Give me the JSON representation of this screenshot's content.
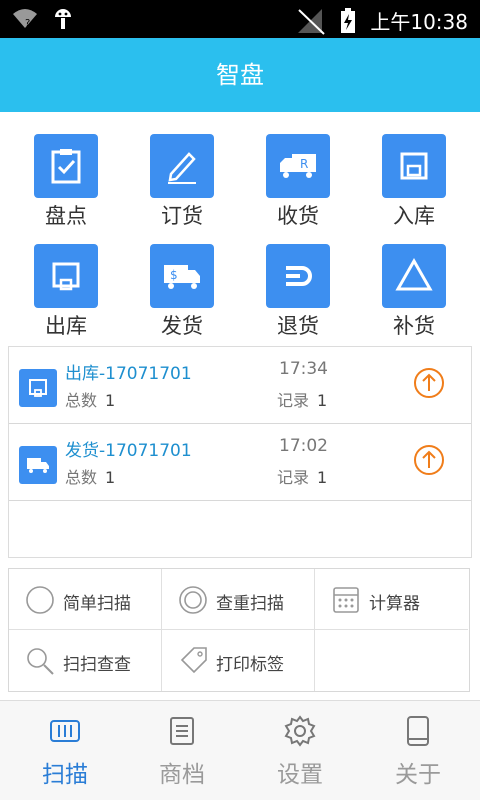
{
  "status": {
    "time": "上午10:38"
  },
  "appbar": {
    "title": "智盘"
  },
  "grid": [
    {
      "label": "盘点",
      "icon": "clipboard-check-icon"
    },
    {
      "label": "订货",
      "icon": "pencil-icon"
    },
    {
      "label": "收货",
      "icon": "truck-r-icon"
    },
    {
      "label": "入库",
      "icon": "inbox-icon"
    },
    {
      "label": "出库",
      "icon": "outbox-icon"
    },
    {
      "label": "发货",
      "icon": "truck-dollar-icon"
    },
    {
      "label": "退货",
      "icon": "return-icon"
    },
    {
      "label": "补货",
      "icon": "triangle-icon"
    }
  ],
  "records": [
    {
      "title": "出库-17071701",
      "time": "17:34",
      "count_label": "总数",
      "count": "1",
      "record_label": "记录",
      "record": "1"
    },
    {
      "title": "发货-17071701",
      "time": "17:02",
      "count_label": "总数",
      "count": "1",
      "record_label": "记录",
      "record": "1"
    }
  ],
  "tools": [
    {
      "label": "简单扫描",
      "icon": "circle-icon"
    },
    {
      "label": "查重扫描",
      "icon": "double-circle-icon"
    },
    {
      "label": "计算器",
      "icon": "calculator-icon"
    },
    {
      "label": "扫扫查查",
      "icon": "search-icon"
    },
    {
      "label": "打印标签",
      "icon": "tag-icon"
    }
  ],
  "tabs": [
    {
      "label": "扫描",
      "icon": "barcode-icon",
      "active": true
    },
    {
      "label": "商档",
      "icon": "document-icon",
      "active": false
    },
    {
      "label": "设置",
      "icon": "gear-icon",
      "active": false
    },
    {
      "label": "关于",
      "icon": "tablet-icon",
      "active": false
    }
  ],
  "colors": {
    "accent": "#2bbfee",
    "tile": "#3d8ff0",
    "link": "#1e8fcf",
    "upload": "#f07d1a",
    "tab_active": "#2a7dd6"
  }
}
